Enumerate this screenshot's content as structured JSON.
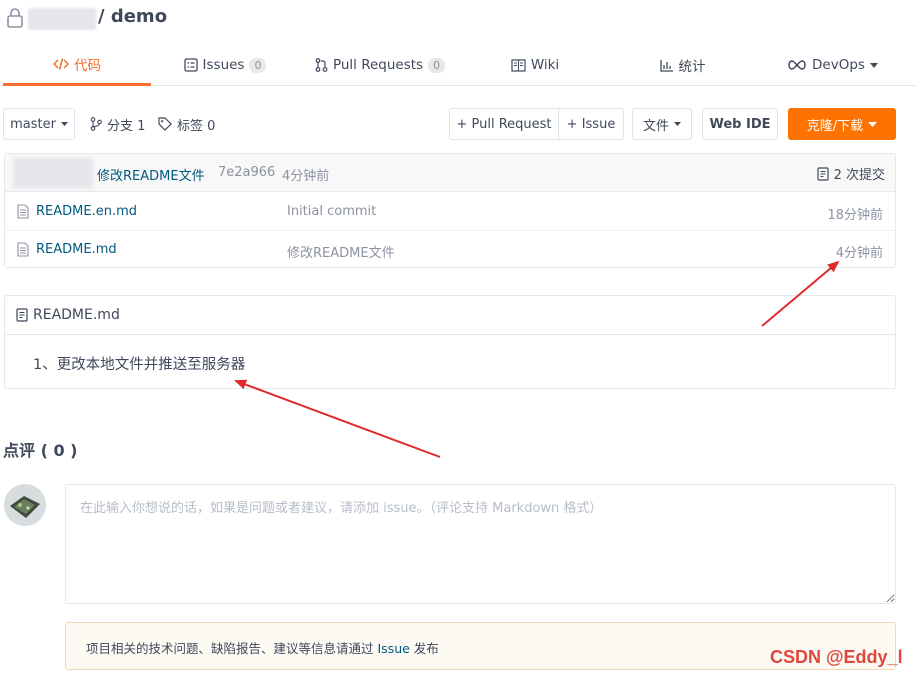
{
  "repo": {
    "owner": "",
    "separator_name": "/ demo"
  },
  "tabs": [
    {
      "label": "代码",
      "icon": "code-icon",
      "active": true
    },
    {
      "label": "Issues",
      "count": "0",
      "icon": "issues-icon"
    },
    {
      "label": "Pull Requests",
      "count": "0",
      "icon": "pull-request-icon"
    },
    {
      "label": "Wiki",
      "icon": "wiki-icon"
    },
    {
      "label": "统计",
      "icon": "stats-icon"
    },
    {
      "label": "DevOps",
      "icon": "devops-icon",
      "dropdown": true
    }
  ],
  "toolbar": {
    "branch_select": "master",
    "branches_label": "分支 1",
    "tags_label": "标签 0",
    "pull_request_button": "+ Pull Request",
    "issue_button": "+ Issue",
    "file_menu": "文件",
    "web_ide_button": "Web IDE",
    "clone_button": "克隆/下载"
  },
  "latest_commit": {
    "message": "修改README文件",
    "sha": "7e2a966",
    "time": "4分钟前",
    "commit_count": "2 次提交"
  },
  "files": [
    {
      "name": "README.en.md",
      "message": "Initial commit",
      "time": "18分钟前"
    },
    {
      "name": "README.md",
      "message": "修改README文件",
      "time": "4分钟前"
    }
  ],
  "readme": {
    "title": "README.md",
    "content": "1、更改本地文件并推送至服务器"
  },
  "comments": {
    "title": "点评 ( 0 )",
    "placeholder": "在此输入你想说的话，如果是问题或者建议，请添加 issue。（评论支持 Markdown 格式）",
    "notice_prefix": "项目相关的技术问题、缺陷报告、建议等信息请通过 ",
    "notice_link": "Issue",
    "notice_suffix": " 发布"
  },
  "watermark": "CSDN @Eddy_l",
  "colors": {
    "accent": "#f56c2d",
    "clone_button": "#fe7300",
    "link": "#005980",
    "arrow": "#e02a2a"
  }
}
